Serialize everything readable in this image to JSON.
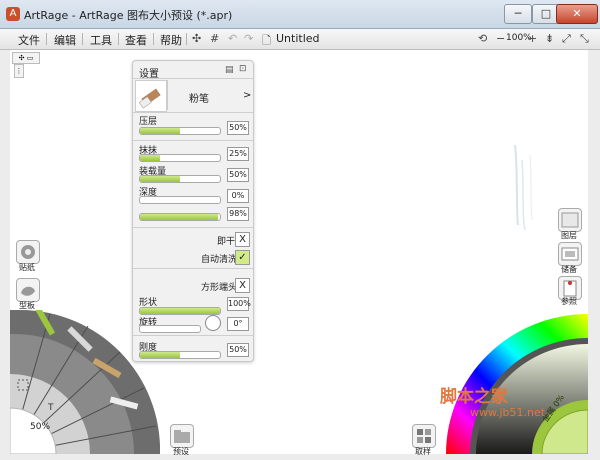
{
  "window": {
    "title": "ArtRage - ArtRage 图布大小预设 (*.apr)",
    "min_label": "─",
    "max_label": "□",
    "close_label": "✕"
  },
  "menubar": {
    "items": [
      "文件",
      "编辑",
      "工具",
      "查看",
      "帮助"
    ],
    "doc_name": "Untitled",
    "zoom": "100%",
    "zoom_minus": "−",
    "zoom_plus": "+"
  },
  "settings": {
    "title": "设置",
    "tool_name": "粉笔",
    "arrow": ">",
    "params": [
      {
        "label": "压层",
        "value": "50%",
        "fill": 0.5
      },
      {
        "label": "抹抹",
        "value": "25%",
        "fill": 0.25
      },
      {
        "label": "装载量",
        "value": "50%",
        "fill": 0.5
      },
      {
        "label": "深度",
        "value": "0%",
        "fill": 0.0
      },
      {
        "label": "",
        "value": "98%",
        "fill": 0.98
      }
    ],
    "dry_label": "即干",
    "dry_mark": "X",
    "autoclean_label": "自动清洗",
    "autoclean_mark": "✓",
    "square_tip_label": "方形端头",
    "square_tip_mark": "X",
    "shape_label": "形状",
    "shape_value": "100%",
    "shape_fill": 1.0,
    "rotate_label": "旋转",
    "rotate_value": "0°",
    "rotate_fill": 0.0,
    "hardness_label": "刚度",
    "hardness_value": "50%",
    "hardness_fill": 0.5
  },
  "left_panel": {
    "tracing_label": "贴纸",
    "stencil_label": "型板",
    "zoom_label": "50%"
  },
  "right_panel": {
    "layers_label": "图层",
    "samples_label": "储备",
    "refs_label": "参照",
    "metallic_label": "金属 0%"
  },
  "bottom": {
    "presets_label": "预设",
    "sample_label": "取样"
  },
  "watermark": {
    "brand": "脚本之家",
    "url": "www.jb51.net"
  }
}
